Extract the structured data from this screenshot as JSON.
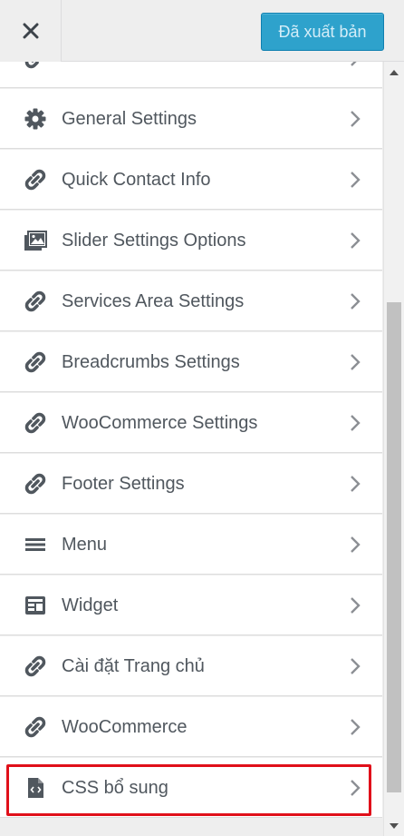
{
  "header": {
    "close_icon": "close-icon",
    "publish_label": "Đã xuất bản",
    "publish_color": "#2ea2cc"
  },
  "menu": {
    "items": [
      {
        "label": "",
        "icon": "link-icon"
      },
      {
        "label": "General Settings",
        "icon": "gear-icon"
      },
      {
        "label": "Quick Contact Info",
        "icon": "link-icon"
      },
      {
        "label": "Slider Settings Options",
        "icon": "images-icon"
      },
      {
        "label": "Services Area Settings",
        "icon": "link-icon"
      },
      {
        "label": "Breadcrumbs Settings",
        "icon": "link-icon"
      },
      {
        "label": "WooCommerce Settings",
        "icon": "link-icon"
      },
      {
        "label": "Footer Settings",
        "icon": "link-icon"
      },
      {
        "label": "Menu",
        "icon": "menu-icon"
      },
      {
        "label": "Widget",
        "icon": "widget-icon"
      },
      {
        "label": "Cài đặt Trang chủ",
        "icon": "link-icon"
      },
      {
        "label": "WooCommerce",
        "icon": "link-icon"
      },
      {
        "label": "CSS bổ sung",
        "icon": "code-file-icon"
      }
    ]
  },
  "highlight_color": "#e0101a"
}
